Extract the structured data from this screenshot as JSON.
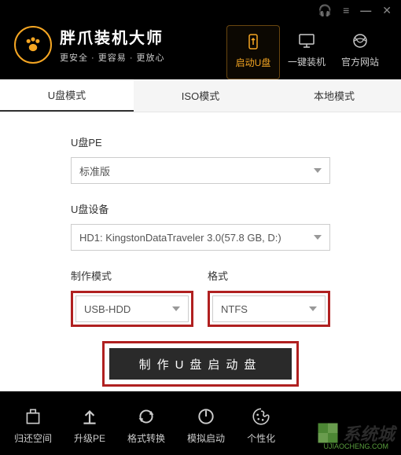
{
  "titlebar": {
    "headset": "🎧",
    "menu": "≡",
    "min": "—",
    "close": "✕"
  },
  "app": {
    "title": "胖爪装机大师",
    "subtitle": "更安全 · 更容易 · 更放心"
  },
  "nav": [
    {
      "label": "启动U盘",
      "active": true
    },
    {
      "label": "一键装机",
      "active": false
    },
    {
      "label": "官方网站",
      "active": false
    }
  ],
  "tabs": [
    {
      "label": "U盘模式",
      "active": true
    },
    {
      "label": "ISO模式",
      "active": false
    },
    {
      "label": "本地模式",
      "active": false
    }
  ],
  "form": {
    "pe_label": "U盘PE",
    "pe_value": "标准版",
    "device_label": "U盘设备",
    "device_value": "HD1: KingstonDataTraveler 3.0(57.8 GB, D:)",
    "mode_label": "制作模式",
    "mode_value": "USB-HDD",
    "format_label": "格式",
    "format_value": "NTFS",
    "button": "制作U盘启动盘"
  },
  "footer": [
    {
      "label": "归还空间"
    },
    {
      "label": "升级PE"
    },
    {
      "label": "格式转换"
    },
    {
      "label": "模拟启动"
    },
    {
      "label": "个性化"
    }
  ],
  "watermark": {
    "text": "系统城",
    "sub": "UJIAOCHENG.COM"
  }
}
